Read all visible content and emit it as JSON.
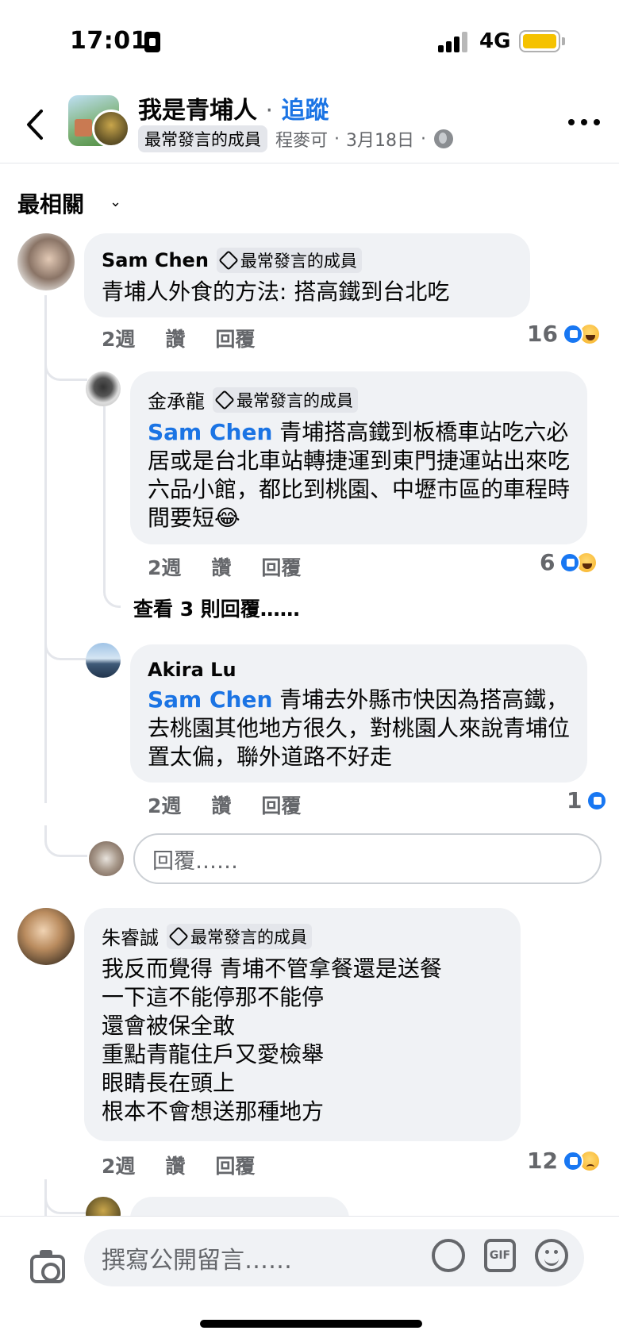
{
  "status_bar": {
    "time": "17:01",
    "network": "4G"
  },
  "header": {
    "title": "我是青埔人",
    "separator": "·",
    "follow": "追蹤",
    "badge": "最常發言的成員",
    "poster": "程麥可",
    "dot": "·",
    "date": "3月18日",
    "dot2": "·"
  },
  "sort": {
    "label": "最相關"
  },
  "member_badge": "最常發言的成員",
  "comments": [
    {
      "author": "Sam Chen",
      "text": "青埔人外食的方法: 搭高鐵到台北吃",
      "time": "2週",
      "like": "讚",
      "reply": "回覆",
      "reaction_count": "16"
    },
    {
      "author": "金承龍",
      "mention": "Sam Chen",
      "text": " 青埔搭高鐵到板橋車站吃六必居或是台北車站轉捷運到東門捷運站出來吃六品小館，都比到桃園、中壢市區的車程時間要短😂",
      "time": "2週",
      "like": "讚",
      "reply": "回覆",
      "reaction_count": "6"
    },
    {
      "author": "Akira Lu",
      "mention": "Sam Chen",
      "text": " 青埔去外縣市快因為搭高鐵，去桃園其他地方很久，對桃園人來說青埔位置太偏，聯外道路不好走",
      "time": "2週",
      "like": "讚",
      "reply": "回覆",
      "reaction_count": "1"
    },
    {
      "author": "朱睿誠",
      "text": "我反而覺得 青埔不管拿餐還是送餐\n一下這不能停那不能停\n還會被保全敢\n重點青龍住戶又愛檢舉\n眼睛長在頭上\n根本不會想送那種地方",
      "time": "2週",
      "like": "讚",
      "reply": "回覆",
      "reaction_count": "12"
    }
  ],
  "view_replies": "查看 3 則回覆……",
  "reply_placeholder": "回覆……",
  "composer": {
    "placeholder": "撰寫公開留言……",
    "gif": "GIF"
  },
  "colors": {
    "link": "#1b74e4",
    "bubble": "#f0f2f5",
    "like": "#1877f2",
    "battery": "#f5c200"
  }
}
